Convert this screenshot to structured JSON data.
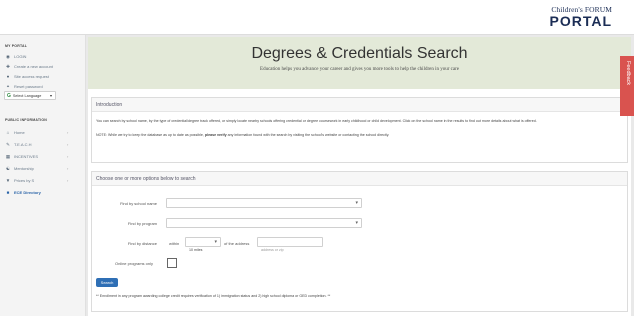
{
  "header": {
    "logo_line1": "Children's FORUM",
    "logo_line2": "PORTAL"
  },
  "sidebar": {
    "my_portal_title": "MY PORTAL",
    "my_portal_items": [
      {
        "icon": "login-icon",
        "label": "LOGIN"
      },
      {
        "icon": "add-user-icon",
        "label": "Create a new account"
      },
      {
        "icon": "user-icon",
        "label": "Site access request"
      },
      {
        "icon": "key-icon",
        "label": "Reset password"
      }
    ],
    "language_label": "Select Language",
    "public_title": "PUBLIC INFORMATION",
    "public_items": [
      {
        "icon": "home-icon",
        "label": "Home"
      },
      {
        "icon": "teach-icon",
        "label": "T.E.A.C.H"
      },
      {
        "icon": "incentives-icon",
        "label": "INCENTIVES"
      },
      {
        "icon": "mentor-icon",
        "label": "Mentorship"
      },
      {
        "icon": "filter-icon",
        "label": "Prices by S"
      },
      {
        "icon": "directory-icon",
        "label": "ECE Directory"
      }
    ]
  },
  "hero": {
    "title": "Degrees & Credentials Search",
    "subtitle": "Education helps you advance your career and gives you more tools to help the children in your care"
  },
  "feedback_tab": "Feedback",
  "intro": {
    "heading": "Introduction",
    "para1": "You can search by school name, by the type of credential/degree track offered, or simply locate nearby schools offering credential or degree coursework in early childhood or child development. Click on the school name in the results to find out more details about what is offered.",
    "para2_prefix": "NOTE: While we try to keep the database as up to date as possible,",
    "para2_bold": "please verify",
    "para2_suffix": "any information found with the search by visiting the school's website or contacting the school directly."
  },
  "search": {
    "heading": "Choose one or more options below to search",
    "school_label": "Find by school name",
    "program_label": "Find by program",
    "distance_label": "Find by distance",
    "within_label": "within",
    "miles_value": "10 miles",
    "of_address_label": "of the address",
    "address_placeholder": "address or zip",
    "online_label": "Online programs only",
    "search_button": "Search",
    "footnote": "** Enrollment in any program awarding college credit requires verification of 1) immigration status and 2) high school diploma or GED completion. **"
  }
}
